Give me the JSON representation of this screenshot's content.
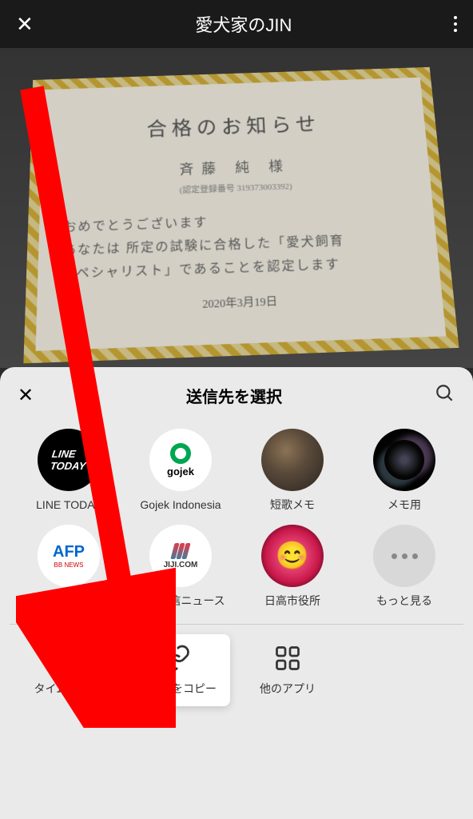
{
  "header": {
    "title": "愛犬家のJIN"
  },
  "certificate": {
    "title": "合格のお知らせ",
    "name": "斉藤 純 様",
    "reg_label": "(認定登録番号",
    "reg_no": "319373003392)",
    "body1": "おめでとうございます",
    "body2": "あなたは 所定の試験に合格した「愛犬飼育",
    "body3": "スペシャリスト」であることを認定します",
    "date": "2020年3月19日"
  },
  "panel": {
    "title": "送信先を選択"
  },
  "destinations": [
    {
      "label": "LINE TODAY"
    },
    {
      "label": "Gojek Indonesia"
    },
    {
      "label": "短歌メモ"
    },
    {
      "label": "メモ用"
    },
    {
      "label": "AFPBB News"
    },
    {
      "label": "時事通信ニュース"
    },
    {
      "label": "日高市役所"
    },
    {
      "label": "もっと見る"
    }
  ],
  "bottom_actions": [
    {
      "label": "タイムライン"
    },
    {
      "label": "リンクをコピー"
    },
    {
      "label": "他のアプリ"
    }
  ],
  "gojek_text": "gojek",
  "line_text1": "LINE",
  "line_text2": "TODAY",
  "afp_text": "AFP",
  "afp_sub": "BB NEWS",
  "jiji_text": "JIJI.COM"
}
